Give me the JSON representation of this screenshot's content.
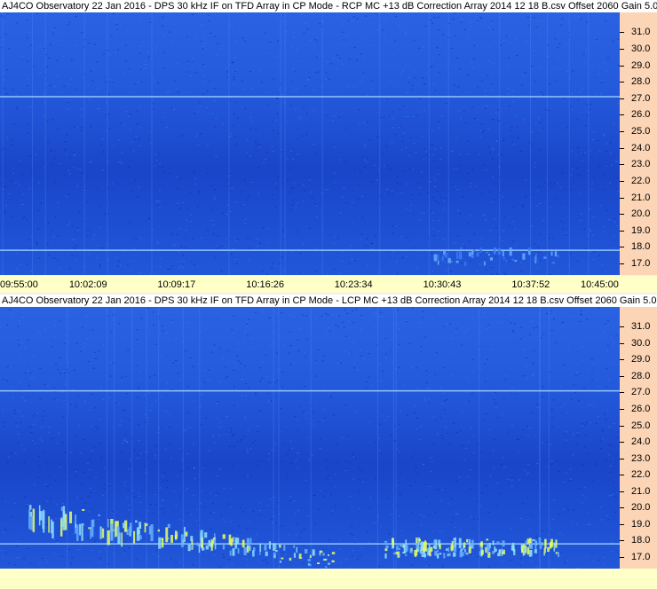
{
  "panels": [
    {
      "title": "AJ4CO Observatory 22 Jan 2016 - DPS 30 kHz IF on TFD Array in CP Mode - RCP  MC +13 dB  Correction Array 2014 12 18 B.csv  Offset 2060  Gain 5.0"
    },
    {
      "title": "AJ4CO Observatory 22 Jan 2016 - DPS 30 kHz IF on TFD Array in CP Mode - LCP  MC +13 dB  Correction Array 2014 12 18 B.csv  Offset 2060  Gain 5.0"
    }
  ],
  "time_axis": {
    "labels": [
      "09:55:00",
      "10:02:09",
      "10:09:17",
      "10:16:26",
      "10:23:34",
      "10:30:43",
      "10:37:52",
      "10:45:00"
    ]
  },
  "chart_data": [
    {
      "type": "heatmap",
      "title": "AJ4CO Observatory 22 Jan 2016 - DPS 30 kHz IF on TFD Array in CP Mode - RCP  MC +13 dB  Correction Array 2014 12 18 B.csv  Offset 2060  Gain 5.0",
      "polarization": "RCP",
      "xlabel": "",
      "ylabel": "",
      "x_ticks": [
        "09:55:00",
        "10:02:09",
        "10:09:17",
        "10:16:26",
        "10:23:34",
        "10:30:43",
        "10:37:52",
        "10:45:00"
      ],
      "y_ticks": [
        "31.0",
        "30.0",
        "29.0",
        "28.0",
        "27.0",
        "26.0",
        "25.0",
        "24.0",
        "23.0",
        "22.0",
        "21.0",
        "20.0",
        "19.0",
        "18.0",
        "17.0"
      ],
      "ylim": [
        16.3,
        32.2
      ],
      "xlim": [
        "09:55:00",
        "10:45:00"
      ],
      "colormap": [
        "#0b2a9e",
        "#1f55d8",
        "#3a7bf0",
        "#66b0ff",
        "#8fe0ff",
        "#e8ff60"
      ],
      "features": [
        {
          "kind": "horizontal-line",
          "freq": 27.1,
          "color": "#9fd4ff"
        },
        {
          "kind": "horizontal-line",
          "freq": 17.8,
          "color": "#9fd4ff"
        },
        {
          "kind": "burst-cluster",
          "freq_range": [
            16.5,
            18.0
          ],
          "time_range": [
            "10:30:00",
            "10:40:00"
          ],
          "intensity": "low"
        }
      ]
    },
    {
      "type": "heatmap",
      "title": "AJ4CO Observatory 22 Jan 2016 - DPS 30 kHz IF on TFD Array in CP Mode - LCP  MC +13 dB  Correction Array 2014 12 18 B.csv  Offset 2060  Gain 5.0",
      "polarization": "LCP",
      "xlabel": "",
      "ylabel": "",
      "y_ticks": [
        "31.0",
        "30.0",
        "29.0",
        "28.0",
        "27.0",
        "26.0",
        "25.0",
        "24.0",
        "23.0",
        "22.0",
        "21.0",
        "20.0",
        "19.0",
        "18.0",
        "17.0"
      ],
      "ylim": [
        16.3,
        32.2
      ],
      "xlim": [
        "09:55:00",
        "10:45:00"
      ],
      "colormap": [
        "#0b2a9e",
        "#1f55d8",
        "#3a7bf0",
        "#66b0ff",
        "#8fe0ff",
        "#e8ff60"
      ],
      "features": [
        {
          "kind": "horizontal-line",
          "freq": 27.1,
          "color": "#9fd4ff"
        },
        {
          "kind": "horizontal-line",
          "freq": 17.8,
          "color": "#9fd4ff"
        },
        {
          "kind": "drifting-bursts",
          "freq_range": [
            16.5,
            20.5
          ],
          "time_range": [
            "09:57:00",
            "10:22:00"
          ],
          "intensity": "high"
        },
        {
          "kind": "burst-cluster",
          "freq_range": [
            16.5,
            18.2
          ],
          "time_range": [
            "10:26:00",
            "10:40:00"
          ],
          "intensity": "high"
        }
      ]
    }
  ]
}
